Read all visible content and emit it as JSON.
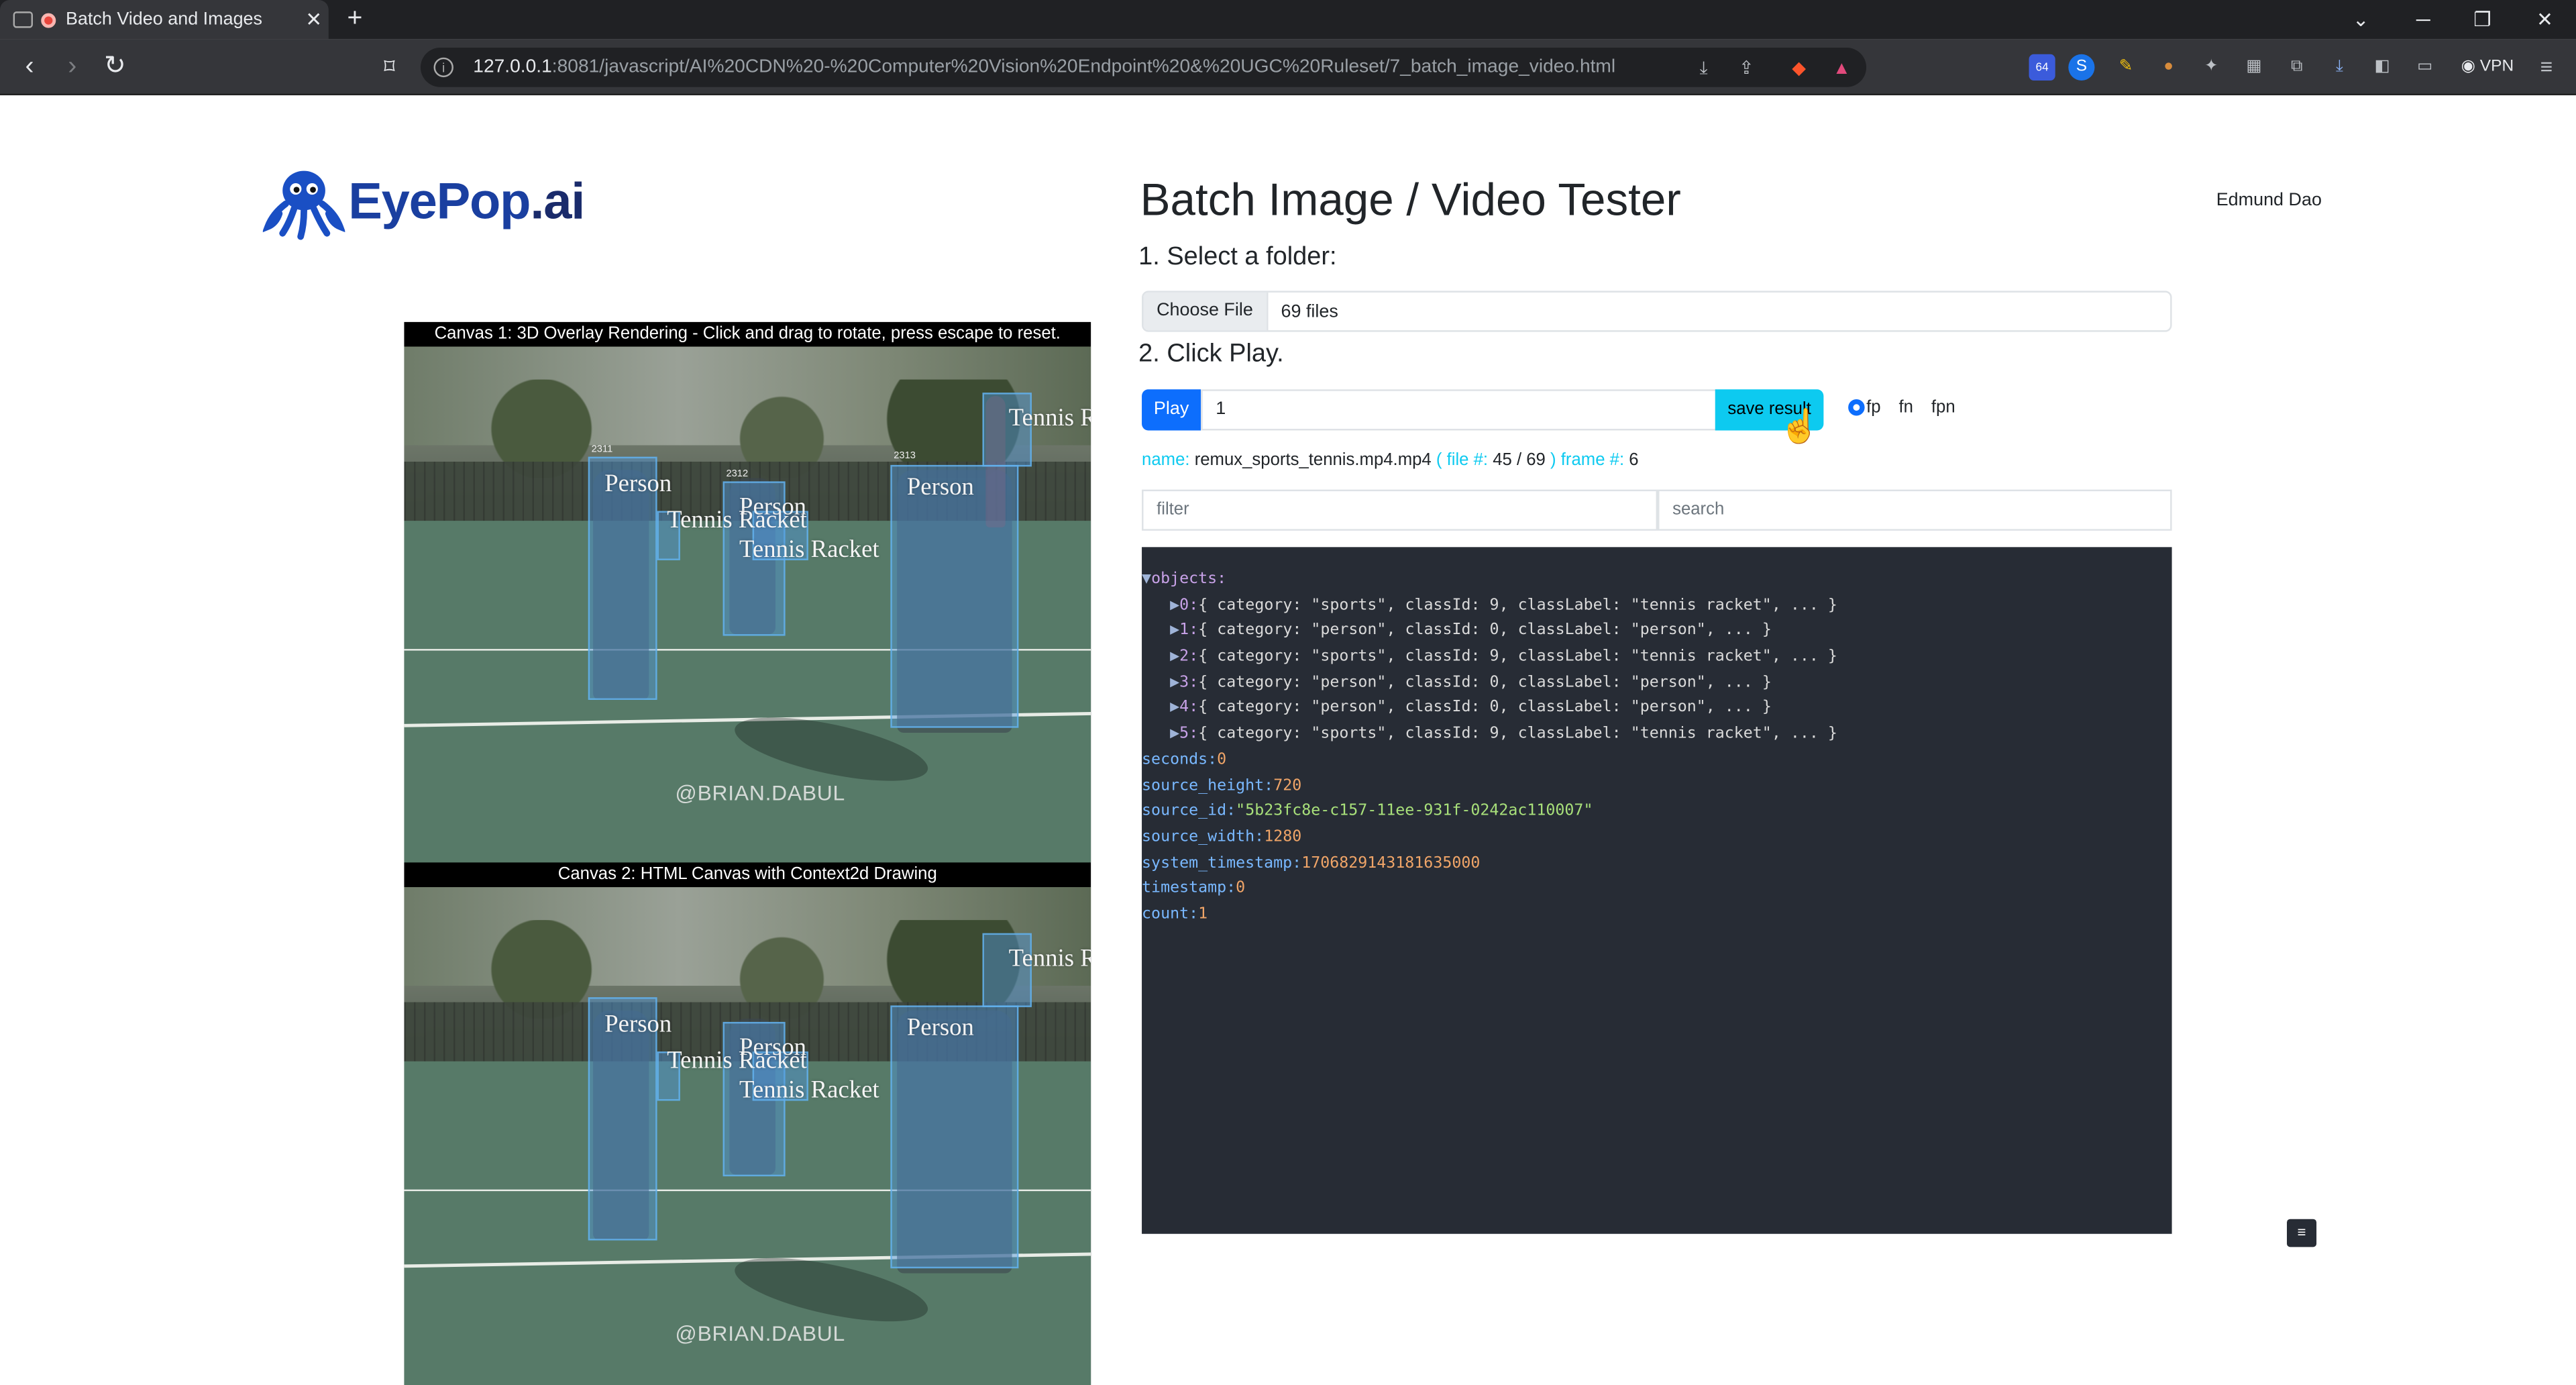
{
  "browser": {
    "tab_title": "Batch Video and Images",
    "url_host": "127.0.0.1",
    "url_rest": ":8081/javascript/AI%20CDN%20-%20Computer%20Vision%20Endpoint%20&%20UGC%20Ruleset/7_batch_image_video.html",
    "vpn_label": "VPN",
    "ext_badge": "64"
  },
  "logo": {
    "eye": "EyePop",
    "ai": ".ai"
  },
  "page": {
    "title": "Batch Image / Video Tester",
    "user": "Edmund Dao",
    "step1": "1. Select a folder:",
    "choose_file": "Choose File",
    "file_status": "69 files",
    "step2": "2. Click Play.",
    "play": "Play",
    "play_value": "1",
    "save_result": "save result",
    "radio_options": [
      "fp",
      "fn",
      "fpn"
    ],
    "name_label": "name:",
    "name_value": "remux_sports_tennis.mp4.mp4",
    "file_label_open": "( file #:",
    "file_num": "45 / 69",
    "file_label_close": ")",
    "frame_label": "frame #:",
    "frame_value": "6",
    "filter_placeholder": "filter",
    "search_placeholder": "search",
    "menu_icon": "≡"
  },
  "canvas1": {
    "title": "Canvas 1: 3D Overlay Rendering - Click and drag to rotate, press escape to reset.",
    "labels": [
      "Person",
      "Person",
      "Tennis Racket",
      "Tennis Racket",
      "Person",
      "Tennis R"
    ],
    "ids": [
      "2311",
      "2312",
      "2313"
    ],
    "watermark": "@BRIAN.DABUL"
  },
  "canvas2": {
    "title": "Canvas 2: HTML Canvas with Context2d Drawing",
    "labels": [
      "Person",
      "Person",
      "Tennis Racket",
      "Tennis Racket",
      "Person",
      "Tennis R"
    ],
    "watermark": "@BRIAN.DABUL"
  },
  "json_view": {
    "root_key": "objects:",
    "objects": [
      {
        "idx": "0",
        "category": "\"sports\"",
        "classId": "9",
        "classLabel": "\"tennis racket\""
      },
      {
        "idx": "1",
        "category": "\"person\"",
        "classId": "0",
        "classLabel": "\"person\""
      },
      {
        "idx": "2",
        "category": "\"sports\"",
        "classId": "9",
        "classLabel": "\"tennis racket\""
      },
      {
        "idx": "3",
        "category": "\"person\"",
        "classId": "0",
        "classLabel": "\"person\""
      },
      {
        "idx": "4",
        "category": "\"person\"",
        "classId": "0",
        "classLabel": "\"person\""
      },
      {
        "idx": "5",
        "category": "\"sports\"",
        "classId": "9",
        "classLabel": "\"tennis racket\""
      }
    ],
    "fields": [
      {
        "key": "seconds",
        "value": "0",
        "type": "num"
      },
      {
        "key": "source_height",
        "value": "720",
        "type": "num"
      },
      {
        "key": "source_id",
        "value": "\"5b23fc8e-c157-11ee-931f-0242ac110007\"",
        "type": "str"
      },
      {
        "key": "source_width",
        "value": "1280",
        "type": "num"
      },
      {
        "key": "system_timestamp",
        "value": "1706829143181635000",
        "type": "num"
      },
      {
        "key": "timestamp",
        "value": "0",
        "type": "num"
      },
      {
        "key": "count",
        "value": "1",
        "type": "num"
      }
    ]
  }
}
